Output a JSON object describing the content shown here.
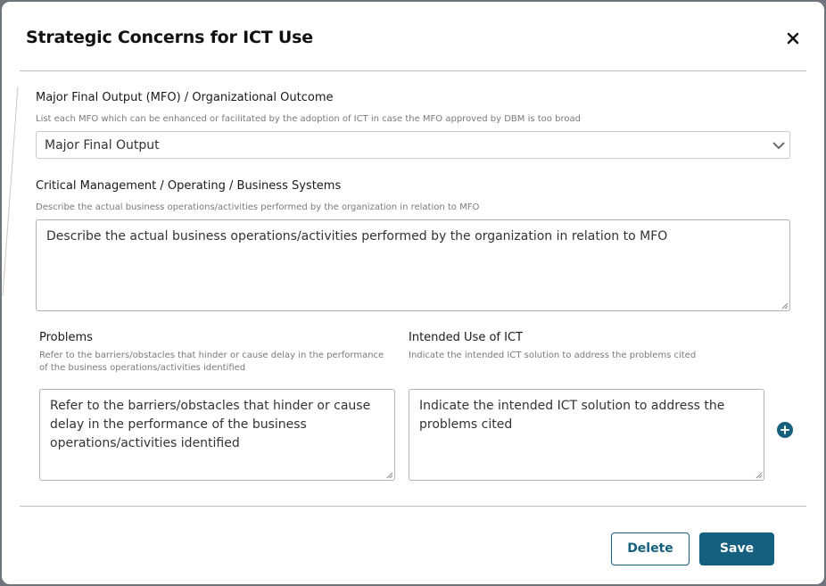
{
  "modal": {
    "title": "Strategic Concerns for ICT Use",
    "close_icon": "close-icon"
  },
  "mfo": {
    "label": "Major Final Output (MFO) / Organizational Outcome",
    "help": "List each MFO which can be enhanced or facilitated by the adoption of ICT in case the MFO approved by DBM is too broad",
    "selected": "Major Final Output",
    "chevron_icon": "chevron-down-icon"
  },
  "systems": {
    "label": "Critical Management / Operating / Business Systems",
    "help": "Describe the actual business operations/activities performed by the organization in relation to MFO",
    "value": "Describe the actual business operations/activities performed by the organization in relation to MFO"
  },
  "problems": {
    "label": "Problems",
    "help": "Refer to the barriers/obstacles that hinder or cause delay in the performance of the business operations/activities identified",
    "value": "Refer to the barriers/obstacles that hinder or cause delay in the performance of the business operations/activities identified"
  },
  "intended_use": {
    "label": "Intended Use of ICT",
    "help": "Indicate the intended ICT solution to address the problems cited",
    "value": "Indicate the intended ICT solution to address the problems cited"
  },
  "add_icon": "plus-circle-icon",
  "footer": {
    "delete_label": "Delete",
    "save_label": "Save"
  },
  "colors": {
    "primary": "#14607e",
    "divider": "#bdbdbd",
    "backdrop": "#6f747a"
  }
}
